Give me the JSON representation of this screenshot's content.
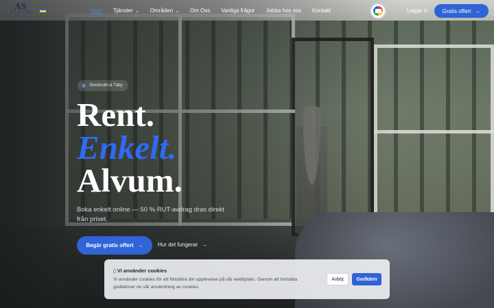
{
  "brand": {
    "logo_mark": "AS",
    "logo_name": "ALVUM",
    "logo_small": "STOCKHOLM",
    "flag_colors": [
      "#2d5fbf",
      "#f5d33b"
    ],
    "accent_color": "#2f63d6"
  },
  "nav": {
    "items": [
      {
        "label": "Hem",
        "active": true,
        "has_dropdown": false
      },
      {
        "label": "Tjänster",
        "active": false,
        "has_dropdown": true
      },
      {
        "label": "Områden",
        "active": false,
        "has_dropdown": true
      },
      {
        "label": "Om Oss",
        "active": false,
        "has_dropdown": false
      },
      {
        "label": "Vanliga frågor",
        "active": false,
        "has_dropdown": false
      },
      {
        "label": "Jobba hos oss",
        "active": false,
        "has_dropdown": false
      },
      {
        "label": "Kontakt",
        "active": false,
        "has_dropdown": false
      }
    ],
    "caret_icon": "chevron-down-icon",
    "badge_icon": "certification-badge-icon",
    "login_label": "Logga in",
    "cta_label": "Gratis offert",
    "cta_icon": "arrow-right-icon"
  },
  "hero": {
    "location_label": "Stockholm & Täby",
    "headline_line1": "Rent.",
    "headline_line2": "Enkelt.",
    "headline_line3": "Alvum.",
    "subtitle": "Boka enkelt online — 50 % RUT-avdrag dras direkt från priset.",
    "primary_cta": "Begär gratis offert",
    "secondary_cta": "Hur det fungerar",
    "arrow": "→"
  },
  "cookie": {
    "title": "Vi använder cookies",
    "text": "Vi använder cookies för att förbättra din upplevelse på vår webbplats. Genom att fortsätta godkänner du vår användning av cookies.",
    "decline_label": "Avböj",
    "accept_label": "Godkänn"
  }
}
